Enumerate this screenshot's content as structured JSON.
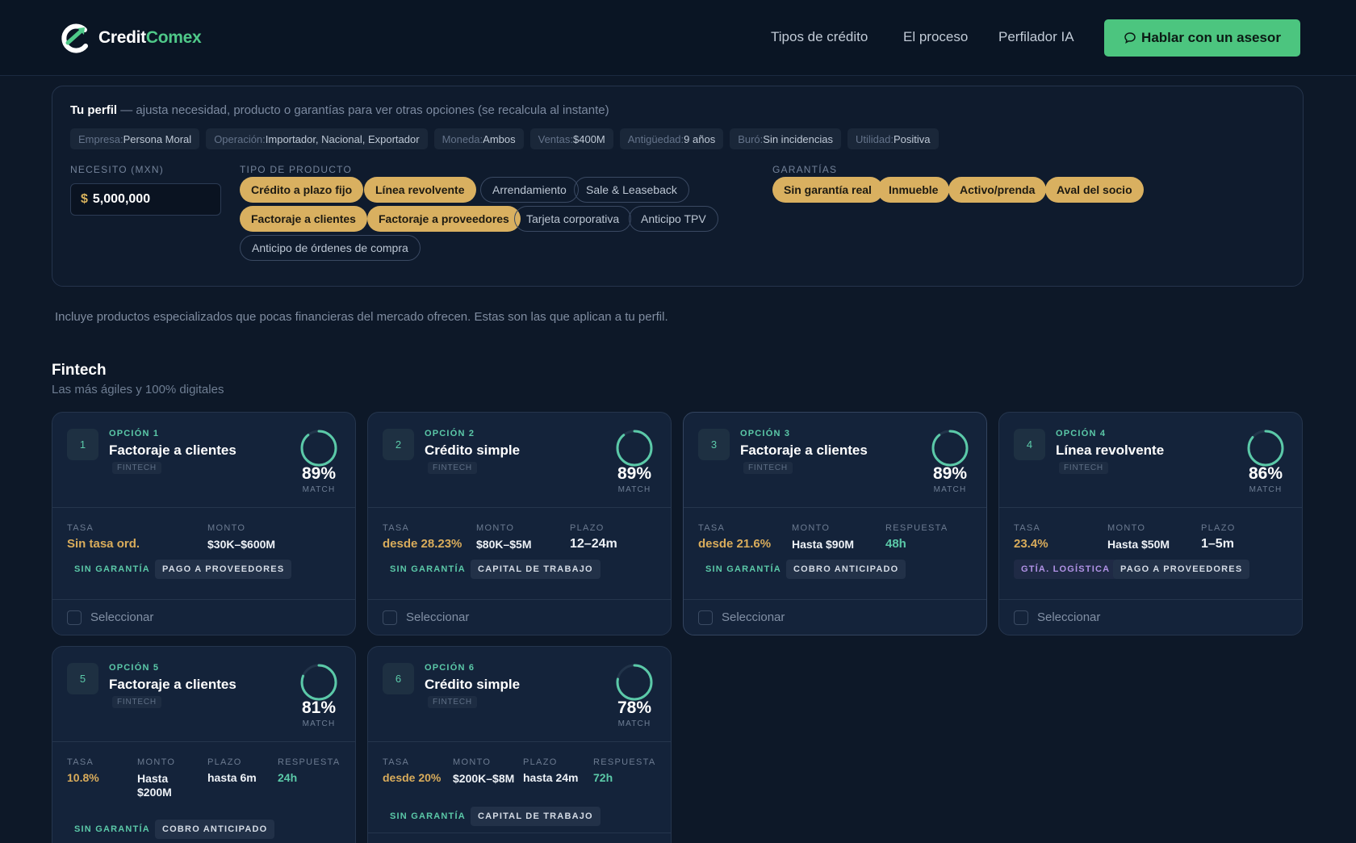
{
  "brand": {
    "part1": "Credit",
    "part2": "Comex",
    "accent": "#4fc989"
  },
  "nav": {
    "items": [
      "Tipos de crédito",
      "El proceso",
      "Perfilador IA"
    ],
    "cta": "Hablar con un asesor"
  },
  "profile": {
    "title": "Tu perfil",
    "subtitle": "— ajusta necesidad, producto o garantías para ver otras opciones (se recalcula al instante)",
    "chips": [
      {
        "k": "Empresa:",
        "v": "Persona Moral"
      },
      {
        "k": "Operación:",
        "v": "Importador, Nacional, Exportador"
      },
      {
        "k": "Moneda:",
        "v": "Ambos"
      },
      {
        "k": "Ventas:",
        "v": "$400M"
      },
      {
        "k": "Antigüedad:",
        "v": "9 años"
      },
      {
        "k": "Buró:",
        "v": "Sin incidencias"
      },
      {
        "k": "Utilidad:",
        "v": "Positiva"
      }
    ],
    "need_label": "NECESITO (MXN)",
    "currency": "$",
    "amount": "5,000,000",
    "product_label": "TIPO DE PRODUCTO",
    "products": [
      {
        "label": "Crédito a plazo fijo",
        "on": true
      },
      {
        "label": "Línea revolvente",
        "on": true
      },
      {
        "label": "Arrendamiento",
        "on": false
      },
      {
        "label": "Sale & Leaseback",
        "on": false
      },
      {
        "label": "Factoraje a clientes",
        "on": true
      },
      {
        "label": "Factoraje a proveedores",
        "on": true
      },
      {
        "label": "Tarjeta corporativa",
        "on": false
      },
      {
        "label": "Anticipo TPV",
        "on": false
      },
      {
        "label": "Anticipo de órdenes de compra",
        "on": false
      }
    ],
    "guarantee_label": "GARANTÍAS",
    "guarantees": [
      "Sin garantía real",
      "Inmueble",
      "Activo/prenda",
      "Aval del socio"
    ]
  },
  "note": "Incluye productos especializados que pocas financieras del mercado ofrecen. Estas son las que aplican a tu perfil.",
  "section": {
    "title": "Fintech",
    "subtitle": "Las más ágiles y 100% digitales"
  },
  "select_label": "Seleccionar",
  "match_label": "MATCH",
  "cards": [
    {
      "num": "1",
      "option": "OPCIÓN 1",
      "title": "Factoraje a clientes",
      "tag": "FINTECH",
      "match": 89,
      "match_text": "89%",
      "metrics": [
        {
          "label": "TASA",
          "value": "Sin tasa ord."
        },
        {
          "label": "MONTO",
          "value": "$30K–$600M"
        }
      ],
      "tags": [
        "SIN GARANTÍA",
        "PAGO A PROVEEDORES"
      ]
    },
    {
      "num": "2",
      "option": "OPCIÓN 2",
      "title": "Crédito simple",
      "tag": "FINTECH",
      "match": 89,
      "match_text": "89%",
      "metrics": [
        {
          "label": "TASA",
          "value": "desde 28.23%"
        },
        {
          "label": "MONTO",
          "value": "$80K–$5M"
        },
        {
          "label": "PLAZO",
          "value": "12–24m"
        }
      ],
      "tags": [
        "SIN GARANTÍA",
        "CAPITAL DE TRABAJO"
      ]
    },
    {
      "num": "3",
      "option": "OPCIÓN 3",
      "title": "Factoraje a clientes",
      "tag": "FINTECH",
      "match": 89,
      "match_text": "89%",
      "metrics": [
        {
          "label": "TASA",
          "value": "desde 21.6%"
        },
        {
          "label": "MONTO",
          "value": "Hasta $90M"
        },
        {
          "label": "RESPUESTA",
          "value": "48h"
        }
      ],
      "tags": [
        "SIN GARANTÍA",
        "COBRO ANTICIPADO"
      ]
    },
    {
      "num": "4",
      "option": "OPCIÓN 4",
      "title": "Línea revolvente",
      "tag": "FINTECH",
      "match": 86,
      "match_text": "86%",
      "metrics": [
        {
          "label": "TASA",
          "value": "23.4%"
        },
        {
          "label": "MONTO",
          "value": "Hasta $50M"
        },
        {
          "label": "PLAZO",
          "value": "1–5m"
        }
      ],
      "tags": [
        "GTÍA. LOGÍSTICA",
        "PAGO A PROVEEDORES"
      ]
    },
    {
      "num": "5",
      "option": "OPCIÓN 5",
      "title": "Factoraje a clientes",
      "tag": "FINTECH",
      "match": 81,
      "match_text": "81%",
      "metrics": [
        {
          "label": "TASA",
          "value": "10.8%"
        },
        {
          "label": "MONTO",
          "value": "Hasta $200M"
        },
        {
          "label": "PLAZO",
          "value": "hasta 6m"
        },
        {
          "label": "RESPUESTA",
          "value": "24h"
        }
      ],
      "tags": [
        "SIN GARANTÍA",
        "COBRO ANTICIPADO"
      ]
    },
    {
      "num": "6",
      "option": "OPCIÓN 6",
      "title": "Crédito simple",
      "tag": "FINTECH",
      "match": 78,
      "match_text": "78%",
      "metrics": [
        {
          "label": "TASA",
          "value": "desde 20%"
        },
        {
          "label": "MONTO",
          "value": "$200K–$8M"
        },
        {
          "label": "PLAZO",
          "value": "hasta 24m"
        },
        {
          "label": "RESPUESTA",
          "value": "72h"
        }
      ],
      "tags": [
        "SIN GARANTÍA",
        "CAPITAL DE TRABAJO"
      ]
    }
  ]
}
